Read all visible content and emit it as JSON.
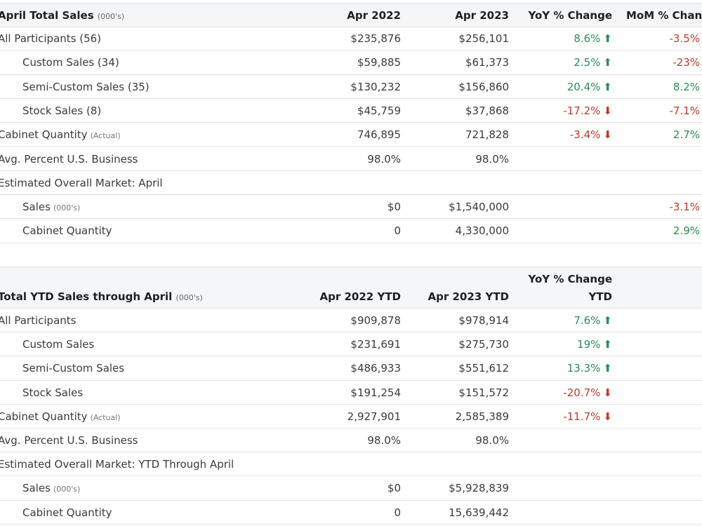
{
  "april": {
    "headers": {
      "title": "April Total Sales",
      "title_unit": "(000's)",
      "c1": "Apr 2022",
      "c2": "Apr 2023",
      "c3": "YoY % Change",
      "c4": "MoM % Change"
    },
    "rows": [
      {
        "label": "All Participants (56)",
        "unit": "",
        "c1": "$235,876",
        "c2": "$256,101",
        "yoy": "8.6%",
        "yoy_dir": "up",
        "mom": "-3.5%",
        "mom_dir": "down"
      },
      {
        "label": "Custom Sales (34)",
        "unit": "",
        "c1": "$59,885",
        "c2": "$61,373",
        "yoy": "2.5%",
        "yoy_dir": "up",
        "mom": "-23%",
        "mom_dir": "down"
      },
      {
        "label": "Semi-Custom Sales (35)",
        "unit": "",
        "c1": "$130,232",
        "c2": "$156,860",
        "yoy": "20.4%",
        "yoy_dir": "up",
        "mom": "8.2%",
        "mom_dir": "up"
      },
      {
        "label": "Stock Sales (8)",
        "unit": "",
        "c1": "$45,759",
        "c2": "$37,868",
        "yoy": "-17.2%",
        "yoy_dir": "down",
        "mom": "-7.1%",
        "mom_dir": "down"
      },
      {
        "label": "Cabinet Quantity",
        "unit": "(Actual)",
        "c1": "746,895",
        "c2": "721,828",
        "yoy": "-3.4%",
        "yoy_dir": "down",
        "mom": "2.7%",
        "mom_dir": "up"
      },
      {
        "label": "Avg. Percent U.S. Business",
        "unit": "",
        "c1": "98.0%",
        "c2": "98.0%",
        "yoy": "",
        "yoy_dir": "",
        "mom": "",
        "mom_dir": ""
      },
      {
        "label": "Estimated Overall Market: April",
        "unit": "",
        "c1": "",
        "c2": "",
        "yoy": "",
        "yoy_dir": "",
        "mom": "",
        "mom_dir": ""
      },
      {
        "label": "Sales",
        "unit": "(000's)",
        "c1": "$0",
        "c2": "$1,540,000",
        "yoy": "",
        "yoy_dir": "",
        "mom": "-3.1%",
        "mom_dir": "down"
      },
      {
        "label": "Cabinet Quantity",
        "unit": "",
        "c1": "0",
        "c2": "4,330,000",
        "yoy": "",
        "yoy_dir": "",
        "mom": "2.9%",
        "mom_dir": "up"
      }
    ]
  },
  "ytd": {
    "headers": {
      "title": "Total YTD Sales through April",
      "title_unit": "(000's)",
      "c1": "Apr 2022 YTD",
      "c2": "Apr 2023 YTD",
      "c3_line1": "YoY % Change",
      "c3_line2": "YTD"
    },
    "rows": [
      {
        "label": "All Participants",
        "unit": "",
        "c1": "$909,878",
        "c2": "$978,914",
        "yoy": "7.6%",
        "yoy_dir": "up"
      },
      {
        "label": "Custom Sales",
        "unit": "",
        "c1": "$231,691",
        "c2": "$275,730",
        "yoy": "19%",
        "yoy_dir": "up"
      },
      {
        "label": "Semi-Custom Sales",
        "unit": "",
        "c1": "$486,933",
        "c2": "$551,612",
        "yoy": "13.3%",
        "yoy_dir": "up"
      },
      {
        "label": "Stock Sales",
        "unit": "",
        "c1": "$191,254",
        "c2": "$151,572",
        "yoy": "-20.7%",
        "yoy_dir": "down"
      },
      {
        "label": "Cabinet Quantity",
        "unit": "(Actual)",
        "c1": "2,927,901",
        "c2": "2,585,389",
        "yoy": "-11.7%",
        "yoy_dir": "down"
      },
      {
        "label": "Avg. Percent U.S. Business",
        "unit": "",
        "c1": "98.0%",
        "c2": "98.0%",
        "yoy": "",
        "yoy_dir": ""
      },
      {
        "label": "Estimated Overall Market: YTD Through April",
        "unit": "",
        "c1": "",
        "c2": "",
        "yoy": "",
        "yoy_dir": ""
      },
      {
        "label": "Sales",
        "unit": "(000's)",
        "c1": "$0",
        "c2": "$5,928,839",
        "yoy": "",
        "yoy_dir": ""
      },
      {
        "label": "Cabinet Quantity",
        "unit": "",
        "c1": "0",
        "c2": "15,639,442",
        "yoy": "",
        "yoy_dir": ""
      }
    ]
  },
  "colors": {
    "up": "#2e8b57",
    "down": "#c0392b",
    "header_bg": "#f5f6f7"
  },
  "icons": {
    "up": "arrow-up-icon",
    "down": "arrow-down-icon"
  }
}
